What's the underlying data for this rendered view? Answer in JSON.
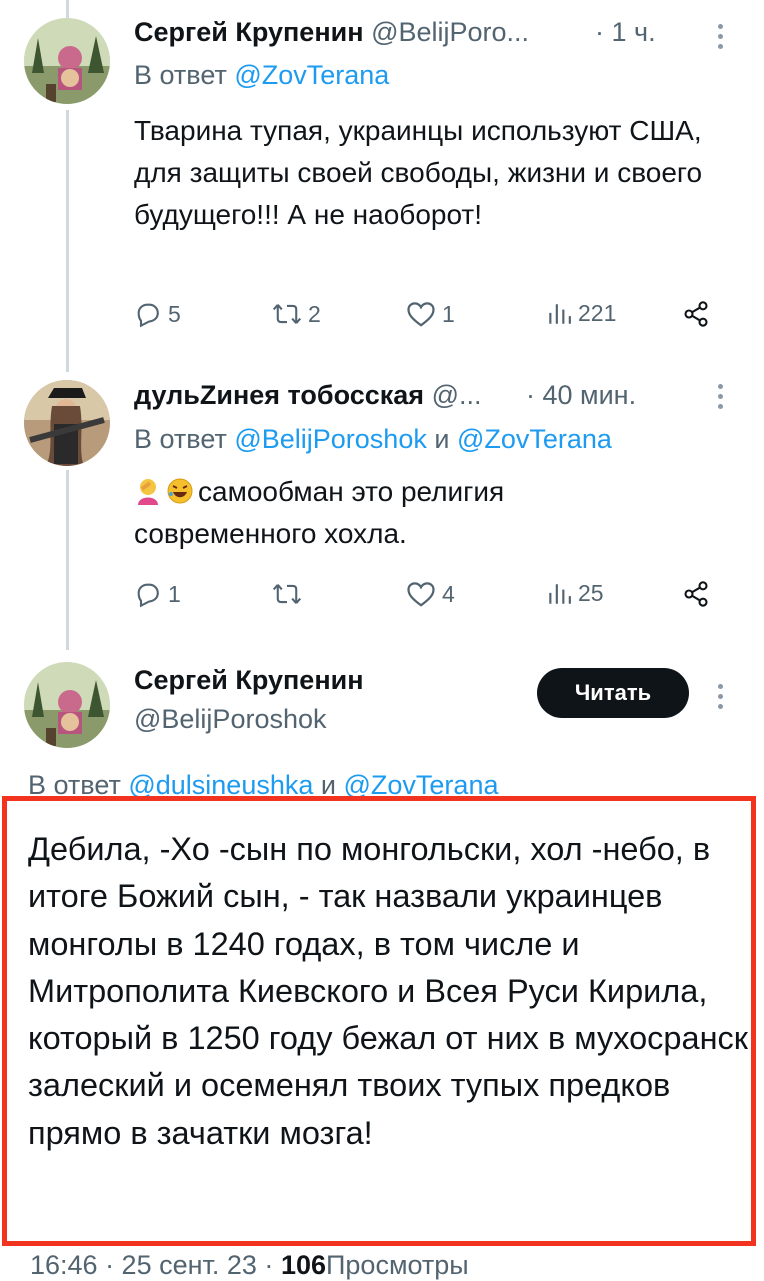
{
  "tweets": [
    {
      "author": "Сергей Крупенин",
      "handle": "@BelijPoro...",
      "time": "· 1 ч.",
      "reply_prefix": "В ответ",
      "reply_to": "@ZovTerana",
      "reply_and": "",
      "reply_to2": "",
      "text": "Тварина тупая, украинцы используют США, для защиты своей свободы, жизни и своего будущего!!! А не наоборот!",
      "replies": "5",
      "retweets": "2",
      "likes": "1",
      "views": "221"
    },
    {
      "author": "дульZинея тобосская",
      "handle": "@...",
      "time": "· 40 мин.",
      "reply_prefix": "В ответ",
      "reply_to": "@BelijPoroshok",
      "reply_and": "и",
      "reply_to2": "@ZovTerana",
      "emojis": [
        "woman-facepalming-emoji",
        "rolling-laughing-emoji"
      ],
      "text": "самообман это религия современного хохла.",
      "replies": "1",
      "retweets": "",
      "likes": "4",
      "views": "25"
    }
  ],
  "main_tweet": {
    "author": "Сергей Крупенин",
    "handle": "@BelijPoroshok",
    "follow_label": "Читать",
    "reply_prefix": "В ответ",
    "reply_to": "@dulsineushka",
    "reply_and": "и",
    "reply_to2": "@ZovTerana",
    "text": "Дебила, -Хо -сын по монгольски, хол -небо, в итоге Божий сын, - так назвали украинцев монголы в 1240 годах, в том числе и Митрополита Киевского и Всея Руси Кирила, который в 1250 году бежал от них в мухосранск залеский и осеменял твоих тупых предков прямо в зачатки мозга!",
    "timestamp": "16:46 · 25 сент. 23 ·",
    "views_count": "106",
    "views_label": "Просмотры"
  },
  "colors": {
    "link": "#1d9bf0",
    "secondary": "#536471",
    "highlight_border": "#f2331f",
    "button_bg": "#0f1419"
  }
}
